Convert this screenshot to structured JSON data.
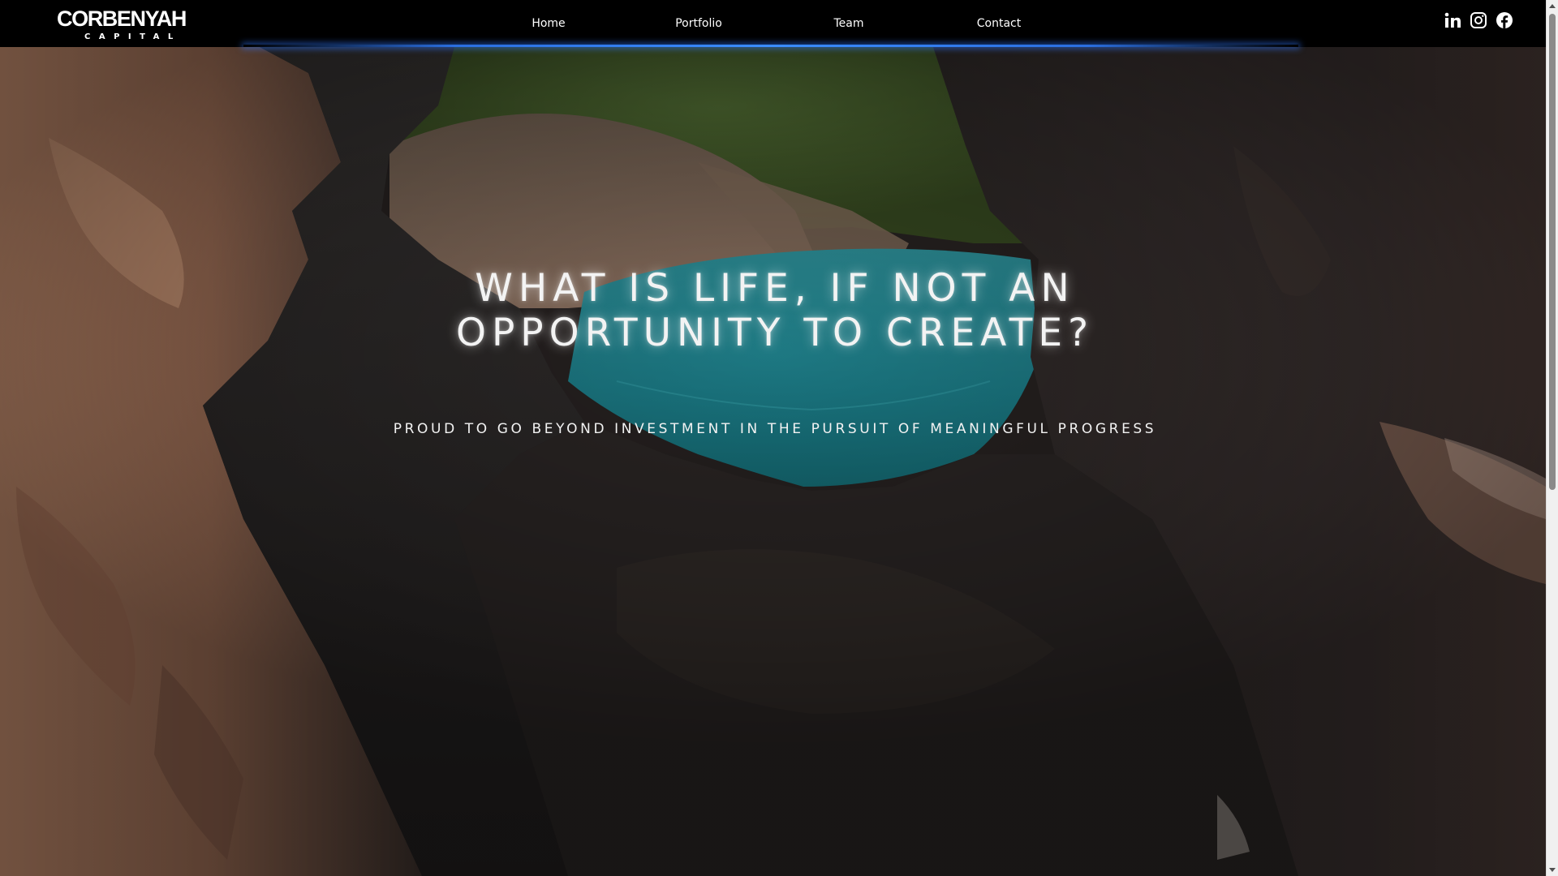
{
  "brand": {
    "name": "CORBENYAH",
    "tagline": "CAPITAL"
  },
  "nav": {
    "items": [
      {
        "label": "Home"
      },
      {
        "label": "Portfolio"
      },
      {
        "label": "Team"
      },
      {
        "label": "Contact"
      }
    ]
  },
  "social": [
    {
      "name": "linkedin-icon"
    },
    {
      "name": "instagram-icon"
    },
    {
      "name": "facebook-icon"
    }
  ],
  "hero": {
    "headline_line1": "WHAT IS LIFE, IF NOT AN",
    "headline_line2": "OPPORTUNITY TO CREATE?",
    "subline": "PROUD TO GO BEYOND INVESTMENT IN THE PURSUIT OF MEANINGFUL PROGRESS"
  },
  "colors": {
    "header_bg": "#000000",
    "header_accent_glow": "#3a8cff",
    "text": "#ffffff",
    "water": "#1f8a93",
    "rock_light": "#c99373",
    "rock_dark": "#2a2524"
  }
}
